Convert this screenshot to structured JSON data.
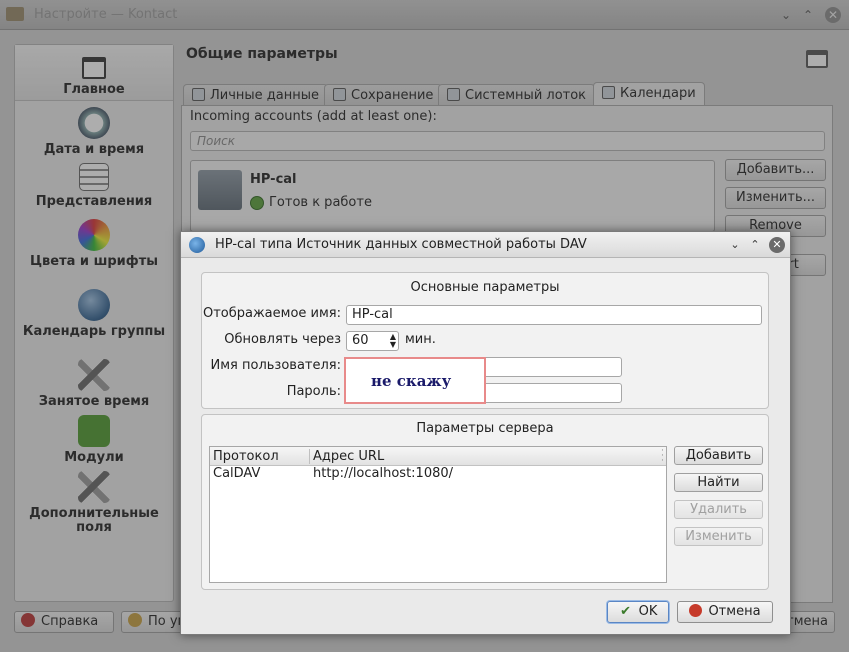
{
  "app": {
    "window_title": "Настройте — Kontact"
  },
  "sidebar": {
    "items": [
      {
        "label": "Главное",
        "selected": true
      },
      {
        "label": "Дата и время"
      },
      {
        "label": "Представления"
      },
      {
        "label": "Цвета и шрифты"
      },
      {
        "label": "Календарь группы"
      },
      {
        "label": "Занятое время"
      },
      {
        "label": "Модули"
      },
      {
        "label": "Дополнительные поля"
      }
    ]
  },
  "main": {
    "heading": "Общие параметры",
    "tabs": [
      {
        "label": "Личные данные"
      },
      {
        "label": "Сохранение"
      },
      {
        "label": "Системный лоток"
      },
      {
        "label": "Календари",
        "active": true
      }
    ],
    "incoming_label": "Incoming accounts (add at least one):",
    "search_placeholder": "Поиск",
    "account": {
      "name": "HP-cal",
      "status": "Готов к работе"
    },
    "side_buttons": {
      "add": "Добавить...",
      "edit": "Изменить...",
      "remove": "Remove",
      "restart": "Restart"
    }
  },
  "bottom_buttons": {
    "help": "Справка",
    "defaults": "По умолчанию",
    "cancel": "Отмена"
  },
  "dialog": {
    "title": "HP-cal типа Источник данных совместной работы DAV",
    "general": {
      "title": "Основные параметры",
      "display_name_label": "Отображаемое имя:",
      "display_name_value": "HP-cal",
      "refresh_label": "Обновлять через",
      "refresh_value": "60",
      "refresh_unit": "мин.",
      "username_label": "Имя пользователя:",
      "password_label": "Пароль:",
      "redacted_note": "не скажу"
    },
    "server": {
      "title": "Параметры сервера",
      "columns": [
        "Протокол",
        "Адрес URL"
      ],
      "rows": [
        {
          "protocol": "CalDAV",
          "url": "http://localhost:1080/"
        }
      ],
      "buttons": {
        "add": "Добавить",
        "find": "Найти",
        "remove": "Удалить",
        "edit": "Изменить"
      }
    },
    "footer": {
      "ok": "OK",
      "cancel": "Отмена"
    }
  },
  "colors": {
    "accent": "#5a86c4",
    "ok_green": "#3a7a2a",
    "cancel_red": "#c63a2a",
    "redaction_border": "#e88a8a"
  }
}
